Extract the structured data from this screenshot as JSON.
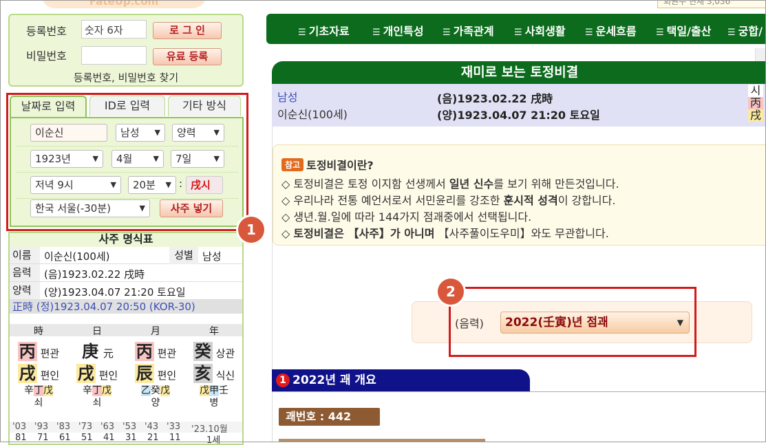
{
  "logo": {
    "text": "FateUp.com"
  },
  "topright": {
    "text": "회원수 현재 3,036"
  },
  "login": {
    "reg_label": "등록번호",
    "reg_placeholder": "숫자 6자",
    "pw_label": "비밀번호",
    "login_button": "로 그 인",
    "paid_button": "유료 등록",
    "find_link": "등록번호, 비밀번호 찾기"
  },
  "input_panel": {
    "tabs": [
      "날짜로 입력",
      "ID로 입력",
      "기타 방식"
    ],
    "name_value": "이순신",
    "gender": "남성",
    "calendar": "양력",
    "year": "1923년",
    "month": "4월",
    "day": "7일",
    "hour": "저녁 9시",
    "minute": "20분",
    "minute_sep": ":",
    "hour_branch": "戌시",
    "location": "한국 서울(-30분)",
    "submit_button": "사주 넣기"
  },
  "markers": {
    "one": "1",
    "two": "2"
  },
  "saju": {
    "title": "사주 명식표",
    "name_label": "이름",
    "name_value": "이순신(100세)",
    "gender_label": "성별",
    "gender_value": "남성",
    "lunar_label": "음력",
    "lunar_value": "(음)1923.02.22 戌時",
    "solar_label": "양력",
    "solar_value": "(양)1923.04.07 21:20 토요일",
    "true_time": "正時 (정)1923.04.07 20:50 (KOR-30)",
    "pillar_headers": [
      "時",
      "日",
      "月",
      "年"
    ],
    "stems": [
      {
        "char": "丙",
        "label": "편관"
      },
      {
        "char": "庚",
        "label": "元"
      },
      {
        "char": "丙",
        "label": "편관"
      },
      {
        "char": "癸",
        "label": "상관"
      }
    ],
    "branches": [
      {
        "char": "戌",
        "label": "편인"
      },
      {
        "char": "戌",
        "label": "편인"
      },
      {
        "char": "辰",
        "label": "편인"
      },
      {
        "char": "亥",
        "label": "식신"
      }
    ],
    "hidden": [
      [
        "辛",
        "丁",
        "戊"
      ],
      [
        "辛",
        "丁",
        "戊"
      ],
      [
        "乙",
        "癸",
        "戊"
      ],
      [
        "戊",
        "甲",
        "壬"
      ]
    ],
    "stages": [
      "쇠",
      "쇠",
      "양",
      "병"
    ],
    "daeun_years": [
      "'03",
      "'93",
      "'83",
      "'73",
      "'63",
      "'53",
      "'43",
      "'33",
      "'23.10월"
    ],
    "daeun_ages": [
      "81",
      "71",
      "61",
      "51",
      "41",
      "31",
      "21",
      "11",
      "1세"
    ]
  },
  "nav": {
    "items": [
      "기초자료",
      "개인특성",
      "가족관계",
      "사회생활",
      "운세흐름",
      "택일/출산",
      "궁합/"
    ]
  },
  "main": {
    "title": "재미로 보는 토정비결",
    "gender": "남성",
    "name": "이순신(100세)",
    "lunar": "(음)1923.02.22 戌時",
    "solar": "(양)1923.04.07 21:20 토요일",
    "pillar_head": "시",
    "pillar_stem": "丙",
    "pillar_branch": "戌"
  },
  "note": {
    "badge": "참고",
    "title": "토정비결이란?",
    "line1_a": "◇ 토정비결은 토정 이지함 선생께서 ",
    "line1_b": "일년 신수",
    "line1_c": "를 보기 위해 만든것입니다.",
    "line2_a": "◇ 우리나라 전통 예언서로서 서민윤리를 강조한 ",
    "line2_b": "훈시적 성격",
    "line2_c": "이 강합니다.",
    "line3": "◇ 생년.월.일에 따라 144가지 점괘중에서 선택됩니다.",
    "line4_a": "◇ ",
    "line4_b": "토정비결은 【사주】가 아니며",
    "line4_c": " 【사주풀이도우미】와도 무관합니다."
  },
  "year_select": {
    "label": "(음력)",
    "value": "2022(壬寅)년 점괘"
  },
  "section": {
    "num": "1",
    "title": "2022년 괘 개요"
  },
  "gwae": {
    "label": "괘번호 : 442"
  },
  "colors": {
    "nav_green": "#0c6b1d",
    "section_blue": "#10128a",
    "highlight_red": "#d11a1a",
    "marker_orange": "#d9573a"
  }
}
